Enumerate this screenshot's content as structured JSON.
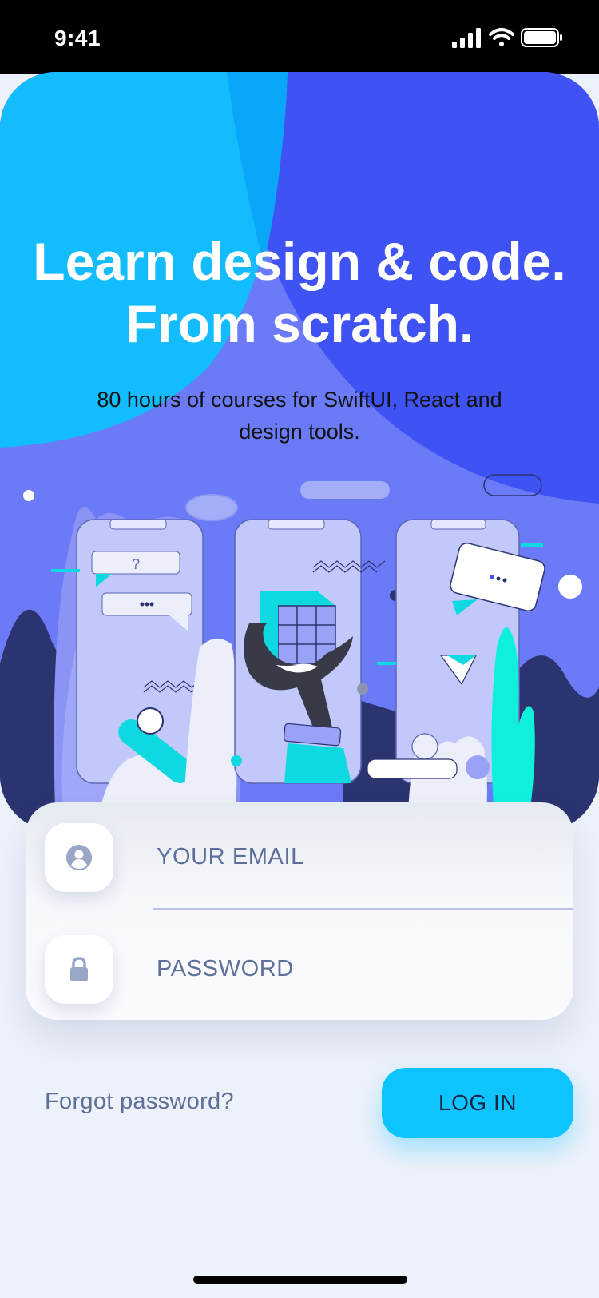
{
  "status_bar": {
    "time": "9:41"
  },
  "hero": {
    "title_line1": "Learn design & code.",
    "title_line2": "From scratch.",
    "subtitle": "80 hours of courses for SwiftUI, React and design tools."
  },
  "illustration": {
    "bubble_text": "?"
  },
  "login_form": {
    "email_label": "YOUR EMAIL",
    "password_label": "PASSWORD",
    "forgot_label": "Forgot password?",
    "login_label": "LOG IN"
  },
  "colors": {
    "accent": "#0ec4ff",
    "hero_blue": "#3f53f4",
    "hero_cyan": "#12bcfd",
    "text_muted": "#5d6f9a",
    "background": "#edf1fa"
  },
  "icons": [
    "cellular-signal-icon",
    "wifi-icon",
    "battery-icon",
    "user-icon",
    "lock-icon"
  ]
}
